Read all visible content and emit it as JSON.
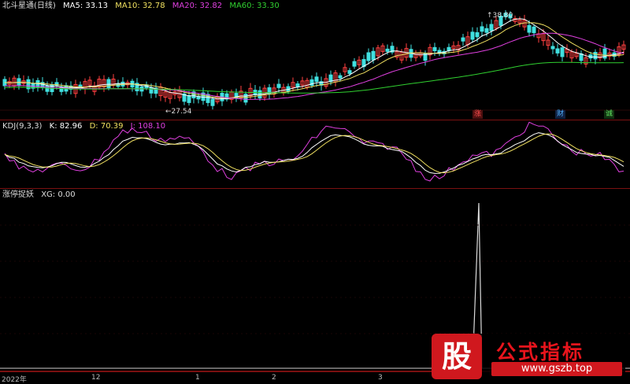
{
  "main": {
    "title": "北斗星通(日线)",
    "ma": [
      {
        "label": "MA5: 33.13",
        "color": "#ffffff"
      },
      {
        "label": "MA10: 32.78",
        "color": "#f0e060"
      },
      {
        "label": "MA20: 32.82",
        "color": "#e040e0"
      },
      {
        "label": "MA60: 33.30",
        "color": "#30d030"
      }
    ],
    "high_label": "38.80",
    "low_label": "27.54",
    "tags": [
      {
        "text": "涨",
        "color": "#ff5050",
        "bg": "#501010"
      },
      {
        "text": "财",
        "color": "#50b0ff",
        "bg": "#102040"
      },
      {
        "text": "诚",
        "color": "#60e060",
        "bg": "#103010"
      }
    ]
  },
  "kdj": {
    "name": "KDJ(9,3,3)",
    "k": "K: 82.96",
    "d": "D: 70.39",
    "j": "J: 108.10",
    "k_color": "#ffffff",
    "d_color": "#f0e060",
    "j_color": "#e040e0"
  },
  "indicator": {
    "name": "涨停捉妖",
    "xg": "XG: 0.00"
  },
  "axis": {
    "labels": [
      "2022年",
      "12",
      "1",
      "2",
      "3"
    ]
  },
  "watermark": {
    "logo": "股",
    "title": "公式指标",
    "url": "www.gszb.top"
  }
}
